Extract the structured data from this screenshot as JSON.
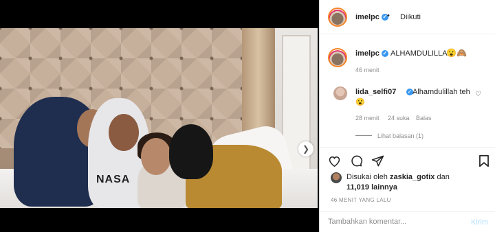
{
  "post": {
    "photo_label": "NASA"
  },
  "header": {
    "username": "imelpc",
    "dot": "•",
    "follow_status": "Diikuti"
  },
  "caption": {
    "username": "imelpc",
    "text": "ALHAMDULILLAH",
    "emoji": "😮🙈",
    "time": "46 menit"
  },
  "comment": {
    "username": "lida_selfi07",
    "text": "Alhamdulillah teh",
    "text_line2": "😮",
    "time": "28 menit",
    "likes": "24 suka",
    "reply": "Balas",
    "view_replies": "Lihat balasan (1)"
  },
  "likes": {
    "prefix": "Disukai oleh",
    "user": "zaskia_gotix",
    "and": "dan",
    "count": "11,019",
    "others": "lainnya"
  },
  "timestamp": "46 MENIT YANG LALU",
  "comment_box": {
    "placeholder": "Tambahkan komentar...",
    "send_label": "Kirim"
  },
  "icons": {
    "verified": "✓",
    "heart": "♡",
    "comment": "◯",
    "share": "➤",
    "bookmark": "⊓",
    "next": "❯"
  },
  "colors": {
    "verified_blue": "#3897f0",
    "send_blue_disabled": "#b2dffc",
    "meta_gray": "#8e8e8e"
  }
}
